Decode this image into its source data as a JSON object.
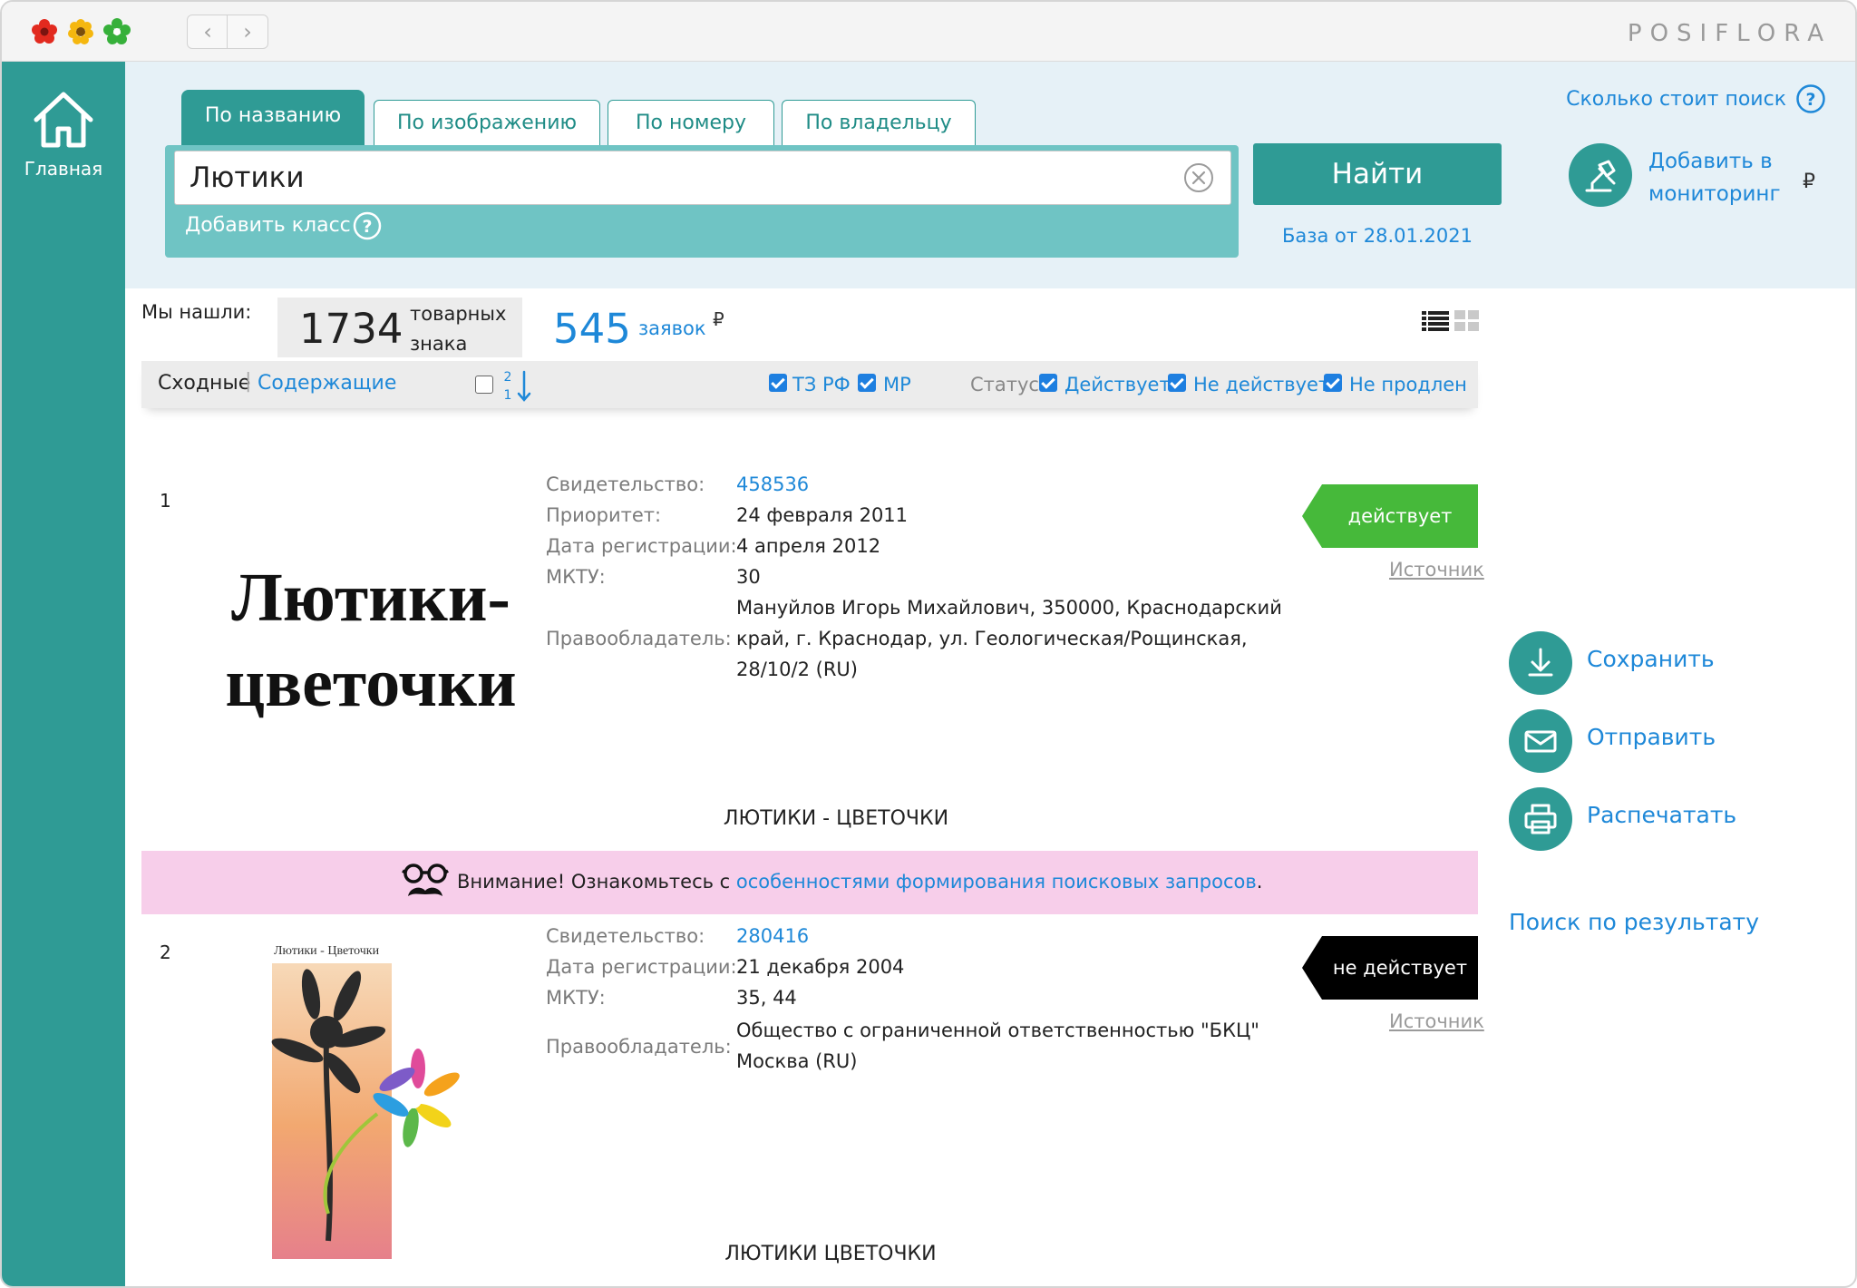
{
  "brand": "POSIFLORA",
  "sidebar": {
    "home_label": "Главная"
  },
  "tabs": [
    {
      "label": "По названию",
      "active": true
    },
    {
      "label": "По изображению",
      "active": false
    },
    {
      "label": "По номеру",
      "active": false
    },
    {
      "label": "По владельцу",
      "active": false
    }
  ],
  "search": {
    "value": "Лютики",
    "add_class_label": "Добавить класс",
    "find_label": "Найти",
    "db_date": "База от 28.01.2021",
    "cost_link": "Сколько стоит поиск",
    "monitor_link": "Добавить в мониторинг",
    "monitor_currency": "₽"
  },
  "summary": {
    "found_label": "Мы нашли:",
    "trademark_count": "1734",
    "trademark_unit": "товарных знака",
    "applications_count": "545",
    "applications_label": "заявок",
    "applications_currency": "₽"
  },
  "filters": {
    "similar": "Сходные",
    "separator": "|",
    "containing": "Содержащие",
    "sort_top": "2",
    "sort_bottom": "1",
    "tz_rf": {
      "label": "ТЗ РФ",
      "checked": true
    },
    "mp": {
      "label": "МР",
      "checked": true
    },
    "status_label": "Статус:",
    "active": {
      "label": "Действует",
      "checked": true
    },
    "inactive": {
      "label": "Не действует",
      "checked": true
    },
    "not_renewed": {
      "label": "Не продлен",
      "checked": true
    }
  },
  "results": [
    {
      "num": "1",
      "logo_text_line1": "Лютики-",
      "logo_text_line2": "цветочки",
      "fields": {
        "certificate_label": "Свидетельство:",
        "certificate": "458536",
        "priority_label": "Приоритет:",
        "priority": "24 февраля 2011",
        "reg_date_label": "Дата регистрации:",
        "reg_date": "4 апреля 2012",
        "mktu_label": "МКТУ:",
        "mktu": "30",
        "owner_label": "Правообладатель:",
        "owner_line1": "Мануйлов Игорь Михайлович, 350000, Краснодарский",
        "owner_line2": "край, г. Краснодар, ул. Геологическая/Рощинская,",
        "owner_line3": "28/10/2 (RU)"
      },
      "status": "действует",
      "status_color": "#46b93a",
      "source_label": "Источник",
      "caption": "ЛЮТИКИ - ЦВЕТОЧКИ"
    },
    {
      "num": "2",
      "logo_caption": "Лютики - Цветочки",
      "fields": {
        "certificate_label": "Свидетельство:",
        "certificate": "280416",
        "reg_date_label": "Дата регистрации:",
        "reg_date": "21 декабря 2004",
        "mktu_label": "МКТУ:",
        "mktu": "35, 44",
        "owner_label": "Правообладатель:",
        "owner_line1": "Общество с ограниченной ответственностью \"БКЦ\"",
        "owner_line2": "Москва (RU)"
      },
      "status": "не действует",
      "status_color": "#000000",
      "source_label": "Источник",
      "caption": "ЛЮТИКИ ЦВЕТОЧКИ"
    }
  ],
  "notice": {
    "prefix": "Внимание! Ознакомьтесь с ",
    "link": "особенностями формирования поисковых запросов",
    "suffix": "."
  },
  "actions": {
    "save": "Сохранить",
    "send": "Отправить",
    "print": "Распечатать",
    "search_in_results": "Поиск по результату"
  },
  "colors": {
    "teal": "#2f9b95",
    "link": "#1e88d8",
    "search_box": "#6fc4c4",
    "notice_bg": "#f7ceea"
  }
}
